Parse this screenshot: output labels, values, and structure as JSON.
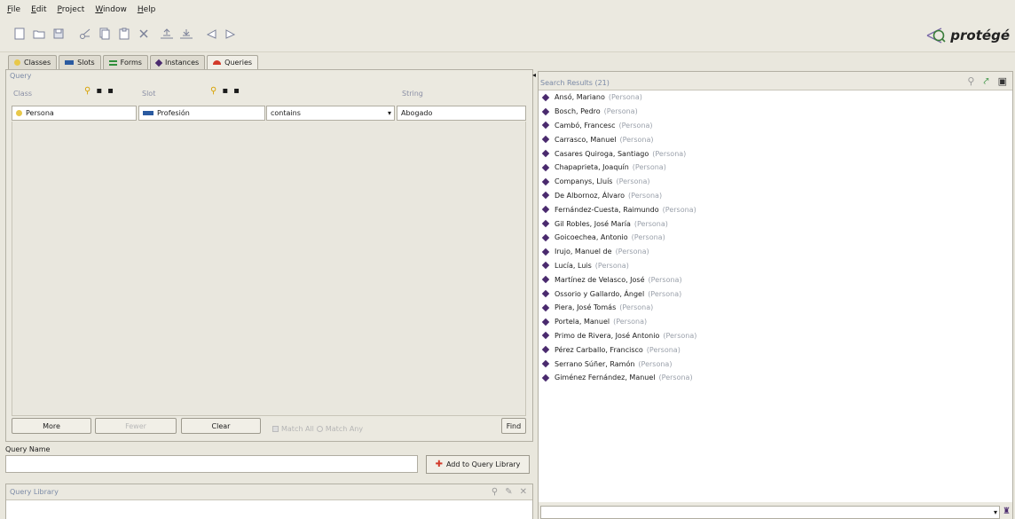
{
  "menu": [
    "File",
    "Edit",
    "Project",
    "Window",
    "Help"
  ],
  "toolbar": {
    "icons": [
      "new-file-icon",
      "open-icon",
      "save-icon",
      "cut-icon",
      "copy-icon",
      "paste-icon",
      "delete-icon",
      "upload-icon",
      "download-icon",
      "back-icon",
      "forward-icon"
    ]
  },
  "logo": {
    "text": "protégé"
  },
  "tabs": [
    {
      "label": "Classes",
      "icon": "class-icon",
      "color": "#e8c84a"
    },
    {
      "label": "Slots",
      "icon": "slot-icon",
      "color": "#2a5aa0"
    },
    {
      "label": "Forms",
      "icon": "form-icon",
      "color": "#2f8f3a"
    },
    {
      "label": "Instances",
      "icon": "instance-icon",
      "color": "#4a2a6e"
    },
    {
      "label": "Queries",
      "icon": "query-icon",
      "color": "#d23a2a"
    }
  ],
  "query": {
    "title": "Query",
    "class_header": "Class",
    "slot_header": "Slot",
    "string_header": "String",
    "class_value": "Persona",
    "slot_value": "Profesión",
    "operator_value": "contains",
    "string_value": "Abogado",
    "more_label": "More",
    "fewer_label": "Fewer",
    "clear_label": "Clear",
    "match_all_label": "Match All",
    "match_any_label": "Match Any",
    "find_label": "Find"
  },
  "query_name": {
    "label": "Query Name",
    "value": "",
    "add_label": "Add to Query Library"
  },
  "query_library": {
    "title": "Query Library"
  },
  "search_results": {
    "title": "Search Results (21)",
    "items": [
      {
        "name": "Ansó, Mariano",
        "type": "(Persona)"
      },
      {
        "name": "Bosch, Pedro",
        "type": "(Persona)"
      },
      {
        "name": "Cambó, Francesc",
        "type": "(Persona)"
      },
      {
        "name": "Carrasco, Manuel",
        "type": "(Persona)"
      },
      {
        "name": "Casares Quiroga, Santiago",
        "type": "(Persona)"
      },
      {
        "name": "Chapaprieta, Joaquín",
        "type": "(Persona)"
      },
      {
        "name": "Companys, Lluís",
        "type": "(Persona)"
      },
      {
        "name": "De Albornoz, Álvaro",
        "type": "(Persona)"
      },
      {
        "name": "Fernández-Cuesta, Raimundo",
        "type": "(Persona)"
      },
      {
        "name": "Gil Robles, José María",
        "type": "(Persona)"
      },
      {
        "name": "Goicoechea, Antonio",
        "type": "(Persona)"
      },
      {
        "name": "Irujo, Manuel de",
        "type": "(Persona)"
      },
      {
        "name": "Lucía, Luis",
        "type": "(Persona)"
      },
      {
        "name": "Martínez de Velasco, José",
        "type": "(Persona)"
      },
      {
        "name": "Ossorio y Gallardo, Ángel",
        "type": "(Persona)"
      },
      {
        "name": "Piera, José Tomás",
        "type": "(Persona)"
      },
      {
        "name": "Portela, Manuel",
        "type": "(Persona)"
      },
      {
        "name": "Primo de Rivera, José Antonio",
        "type": "(Persona)"
      },
      {
        "name": "Pérez Carballo, Francisco",
        "type": "(Persona)"
      },
      {
        "name": "Serrano Súñer, Ramón",
        "type": "(Persona)"
      },
      {
        "name": "Giménez Fernández, Manuel",
        "type": "(Persona)"
      }
    ]
  }
}
